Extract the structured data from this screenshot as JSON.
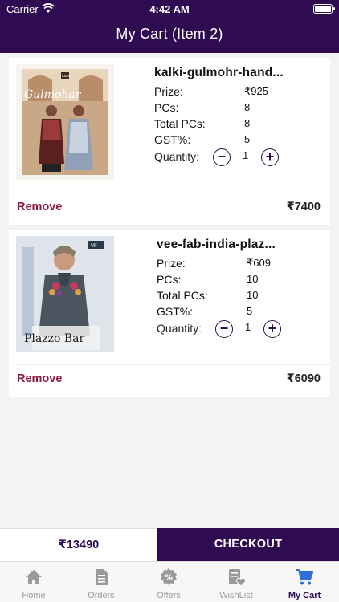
{
  "status": {
    "carrier": "Carrier",
    "time": "4:42 AM"
  },
  "header": {
    "title": "My Cart (Item 2)"
  },
  "items": [
    {
      "name": "kalki-gulmohr-hand...",
      "thumb_label": "Gulmohar",
      "thumb_brand": "KALKI",
      "rows": [
        {
          "label": "Prize:",
          "value": "₹925"
        },
        {
          "label": "PCs:",
          "value": "8"
        },
        {
          "label": "Total PCs:",
          "value": "8"
        },
        {
          "label": "GST%:",
          "value": "5"
        }
      ],
      "quantity_label": "Quantity:",
      "quantity": "1",
      "remove": "Remove",
      "subtotal": "₹7400"
    },
    {
      "name": "vee-fab-india-plaz...",
      "thumb_label": "Plazzo Bar",
      "thumb_brand": "VF",
      "rows": [
        {
          "label": "Prize:",
          "value": "₹609"
        },
        {
          "label": "PCs:",
          "value": "10"
        },
        {
          "label": "Total PCs:",
          "value": "10"
        },
        {
          "label": "GST%:",
          "value": "5"
        }
      ],
      "quantity_label": "Quantity:",
      "quantity": "1",
      "remove": "Remove",
      "subtotal": "₹6090"
    }
  ],
  "footer": {
    "total": "₹13490",
    "checkout": "CHECKOUT"
  },
  "tabs": [
    {
      "label": "Home",
      "icon": "home-icon"
    },
    {
      "label": "Orders",
      "icon": "orders-icon"
    },
    {
      "label": "Offers",
      "icon": "offers-icon"
    },
    {
      "label": "WishList",
      "icon": "wishlist-icon"
    },
    {
      "label": "My Cart",
      "icon": "cart-icon",
      "active": true
    }
  ],
  "colors": {
    "primary": "#2f0c52",
    "remove": "#8b1a3e",
    "inactive": "#9a9a9a"
  }
}
